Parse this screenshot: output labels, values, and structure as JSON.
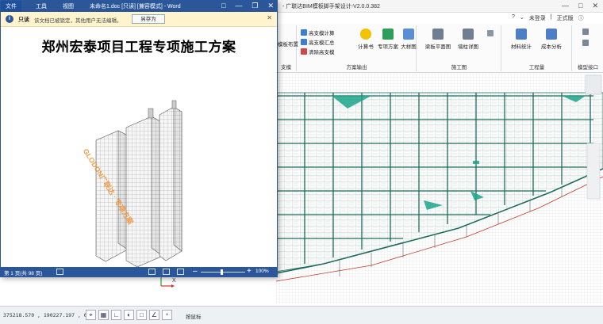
{
  "cad": {
    "title": "- 广联达BIM模板脚手架设计-V2.0.0.382",
    "user": {
      "not_logged_in": "未登录",
      "edition": "正式版"
    },
    "ribbon": {
      "group1": {
        "btn_layout": "模板布置",
        "label": "支模"
      },
      "group_calc": {
        "small": [
          "高支模计算",
          "高支模汇总",
          "清除高支模"
        ],
        "calc_book": "计算书",
        "special_plan": "专项方案",
        "large_drawing": "大样图",
        "label": "方案输出"
      },
      "group_draw": {
        "beam_plan": "梁板平面图",
        "wall_column": "墙柱详图",
        "label": "施工图"
      },
      "group_qty": {
        "material": "材料统计",
        "cost": "成本分析",
        "label": "工程量"
      },
      "group_iface": {
        "label": "模型接口"
      }
    },
    "status": {
      "coordinates": "375218.570 , 190227.197 , 0.00",
      "hint": "按鼠标"
    },
    "axis_x": "X"
  },
  "word": {
    "menu": {
      "file": "文件",
      "tools": "工具",
      "view": "视图"
    },
    "doc_name": "未命名1.doc [只读] [兼容模式] - Word",
    "infobar": {
      "bold": "只读",
      "message": "该文档已被锁定，其他用户无法编辑。",
      "save_as": "另存为"
    },
    "document_title": "郑州宏泰项目工程专项施工方案",
    "watermark": "GLODON广联达 · 专项方案",
    "status": {
      "page_count": "第 1 页(共 98 页)",
      "zoom": "100%"
    }
  },
  "colors": {
    "word_blue": "#2b579a",
    "infobar_bg": "#fff4ce",
    "cad_line": "#1f6b5c",
    "cad_accent": "#1aa58a"
  }
}
